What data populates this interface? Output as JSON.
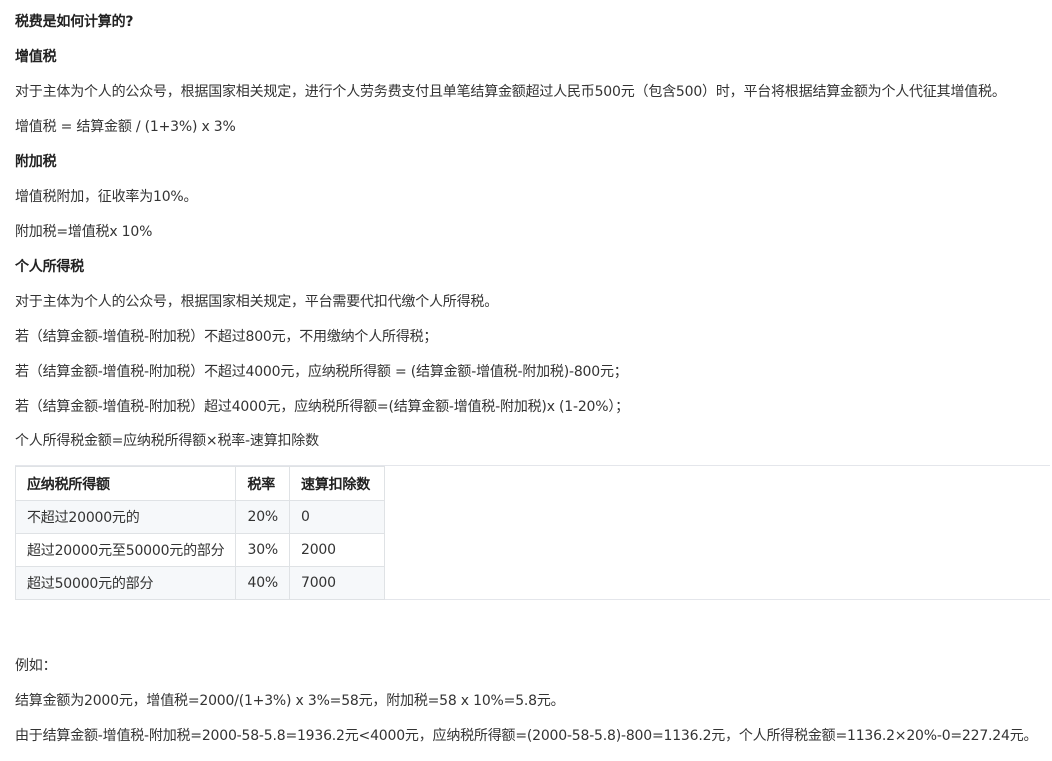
{
  "title": "税费是如何计算的?",
  "vat": {
    "heading": "增值税",
    "desc": "对于主体为个人的公众号，根据国家相关规定，进行个人劳务费支付且单笔结算金额超过人民币500元（包含500）时，平台将根据结算金额为个人代征其增值税。",
    "formula": "增值税 = 结算金额 / (1+3%) x 3%"
  },
  "surtax": {
    "heading": "附加税",
    "desc": "增值税附加，征收率为10%。",
    "formula": "附加税=增值税x 10%"
  },
  "income_tax": {
    "heading": "个人所得税",
    "desc": "对于主体为个人的公众号，根据国家相关规定，平台需要代扣代缴个人所得税。",
    "rule1": "若（结算金额-增值税-附加税）不超过800元，不用缴纳个人所得税；",
    "rule2": "若（结算金额-增值税-附加税）不超过4000元，应纳税所得额 = (结算金额-增值税-附加税)-800元；",
    "rule3": "若（结算金额-增值税-附加税）超过4000元，应纳税所得额=(结算金额-增值税-附加税)x (1-20%）；",
    "formula": "个人所得税金额=应纳税所得额×税率-速算扣除数"
  },
  "table": {
    "headers": [
      "应纳税所得额",
      "税率",
      "速算扣除数"
    ],
    "rows": [
      [
        "不超过20000元的",
        "20%",
        "0"
      ],
      [
        "超过20000元至50000元的部分",
        "30%",
        "2000"
      ],
      [
        "超过50000元的部分",
        "40%",
        "7000"
      ]
    ]
  },
  "example": {
    "label": "例如：",
    "line1": "结算金额为2000元，增值税=2000/(1+3%) x 3%=58元，附加税=58 x 10%=5.8元。",
    "line2": "由于结算金额-增值税-附加税=2000-58-5.8=1936.2元<4000元，应纳税所得额=(2000-58-5.8)-800=1136.2元，个人所得税金额=1136.2×20%-0=227.24元。"
  }
}
